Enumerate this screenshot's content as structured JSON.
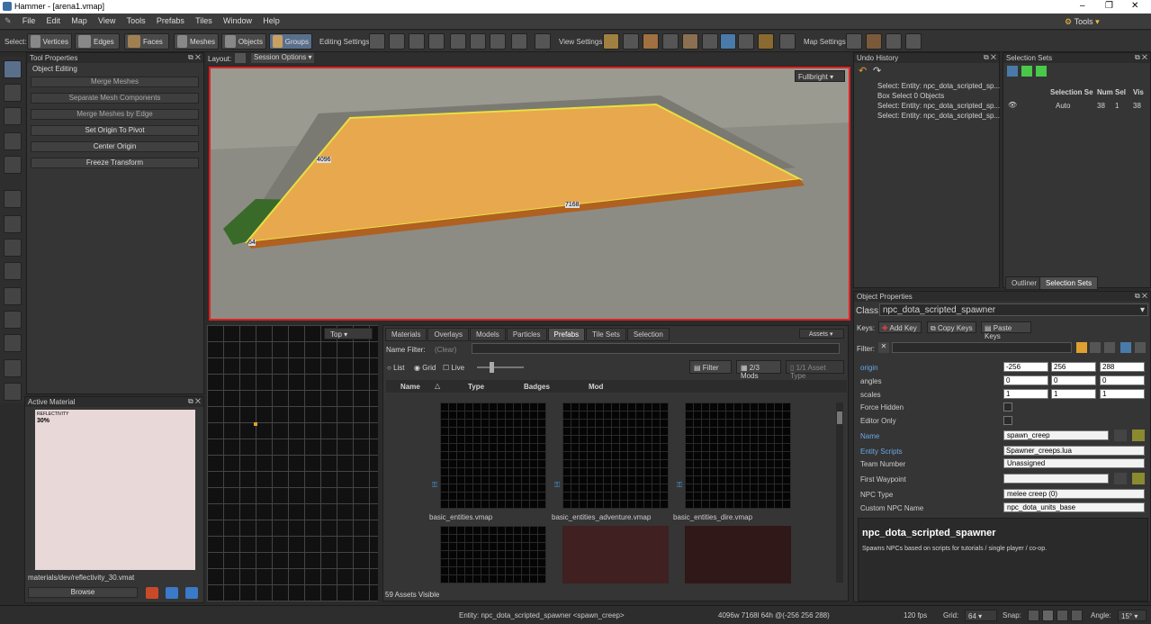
{
  "window": {
    "title": "Hammer - [arena1.vmap]"
  },
  "menu": [
    "File",
    "Edit",
    "Map",
    "View",
    "Tools",
    "Prefabs",
    "Tiles",
    "Window",
    "Help"
  ],
  "menu_right": "Tools",
  "toolbar": {
    "select_label": "Select:",
    "modes": [
      "Vertices",
      "Edges",
      "Faces",
      "Meshes",
      "Objects",
      "Groups"
    ],
    "editing_label": "Editing Settings:",
    "view_label": "View Settings:",
    "map_label": "Map Settings:"
  },
  "layout": {
    "label": "Layout:",
    "session": "Session Options"
  },
  "tool_properties": {
    "title": "Tool Properties",
    "section": "Object Editing",
    "buttons": [
      "Merge Meshes",
      "Separate Mesh Components",
      "Merge Meshes by Edge",
      "Set Origin To Pivot",
      "Center Origin",
      "Freeze Transform"
    ]
  },
  "active_material": {
    "title": "Active Material",
    "tag": "REFLECTIVITY",
    "value": "30%",
    "path": "materials/dev/reflectivity_30.vmat",
    "browse": "Browse"
  },
  "viewport": {
    "mode": "Fullbright",
    "dims": [
      "4096",
      "7168",
      "64"
    ]
  },
  "view2d": {
    "mode": "Top"
  },
  "assets": {
    "tabs": [
      "Materials",
      "Overlays",
      "Models",
      "Particles",
      "Prefabs",
      "Tile Sets",
      "Selection"
    ],
    "active_tab": "Prefabs",
    "assets_btn": "Assets",
    "name_filter_label": "Name Filter:",
    "clear": "(Clear)",
    "list": "List",
    "grid": "Grid",
    "live": "Live",
    "filter": "Filter",
    "mods": "2/3 Mods",
    "asset_type": "1/1 Asset Type",
    "columns": [
      "Name",
      "Type",
      "Badges",
      "Mod"
    ],
    "items": [
      "basic_entities.vmap",
      "basic_entities_adventure.vmap",
      "basic_entities_dire.vmap"
    ],
    "count": "59 Assets Visible"
  },
  "undo": {
    "title": "Undo History",
    "items": [
      "Select: Entity: npc_dota_scripted_sp...",
      "Box Select 0 Objects",
      "Select: Entity: npc_dota_scripted_sp...",
      "Select: Entity: npc_dota_scripted_sp..."
    ]
  },
  "selection_sets": {
    "title": "Selection Sets",
    "cols": [
      "Selection Se",
      "Num",
      "Sel",
      "Vis"
    ],
    "row": {
      "name": "Auto",
      "num": "38",
      "sel": "1",
      "vis": "38"
    },
    "tabs": [
      "Outliner",
      "Selection Sets"
    ]
  },
  "object_properties": {
    "title": "Object Properties",
    "class_label": "Class:",
    "class": "npc_dota_scripted_spawner",
    "keys_label": "Keys:",
    "add_key": "Add Key",
    "copy_keys": "Copy Keys",
    "paste_keys": "Paste Keys",
    "filter_label": "Filter:",
    "props": {
      "origin": {
        "k": "origin",
        "v": [
          "-256",
          "256",
          "288"
        ]
      },
      "angles": {
        "k": "angles",
        "v": [
          "0",
          "0",
          "0"
        ]
      },
      "scales": {
        "k": "scales",
        "v": [
          "1",
          "1",
          "1"
        ]
      },
      "force_hidden": "Force Hidden",
      "editor_only": "Editor Only",
      "name": {
        "k": "Name",
        "v": "spawn_creep"
      },
      "scripts": {
        "k": "Entity Scripts",
        "v": "Spawner_creeps.lua"
      },
      "team": {
        "k": "Team Number",
        "v": "Unassigned"
      },
      "waypoint": {
        "k": "First Waypoint",
        "v": ""
      },
      "npc_type": {
        "k": "NPC Type",
        "v": "melee creep (0)"
      },
      "custom": {
        "k": "Custom NPC Name",
        "v": "npc_dota_units_base"
      }
    },
    "desc_title": "npc_dota_scripted_spawner",
    "desc": "Spawns NPCs based on scripts for tutorials / single player / co-op."
  },
  "status": {
    "entity": "Entity: npc_dota_scripted_spawner <spawn_creep>",
    "dims": "4096w 7168l 64h @(-256 256 288)",
    "fps": "120 fps",
    "grid_label": "Grid:",
    "grid": "64",
    "snap_label": "Snap:",
    "angle_label": "Angle:",
    "angle": "15°"
  }
}
